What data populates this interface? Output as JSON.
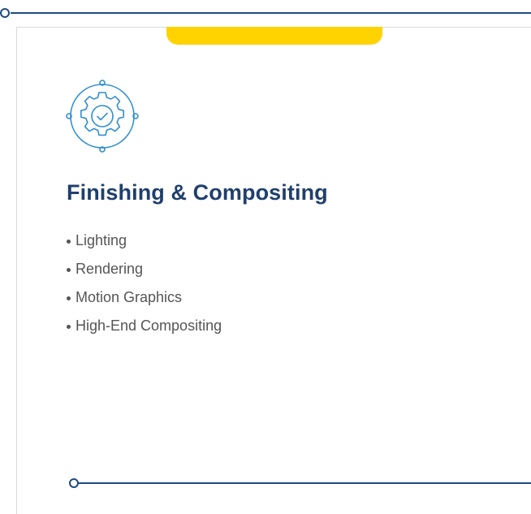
{
  "colors": {
    "navy": "#1f4b82",
    "title": "#203f6d",
    "accent": "#ffd200",
    "icon_blue": "#2f8fd0",
    "text": "#555555"
  },
  "icon": "gear-check-icon",
  "card": {
    "title": "Finishing & Compositing",
    "items": [
      "Lighting",
      "Rendering",
      "Motion Graphics",
      "High-End Compositing"
    ]
  }
}
